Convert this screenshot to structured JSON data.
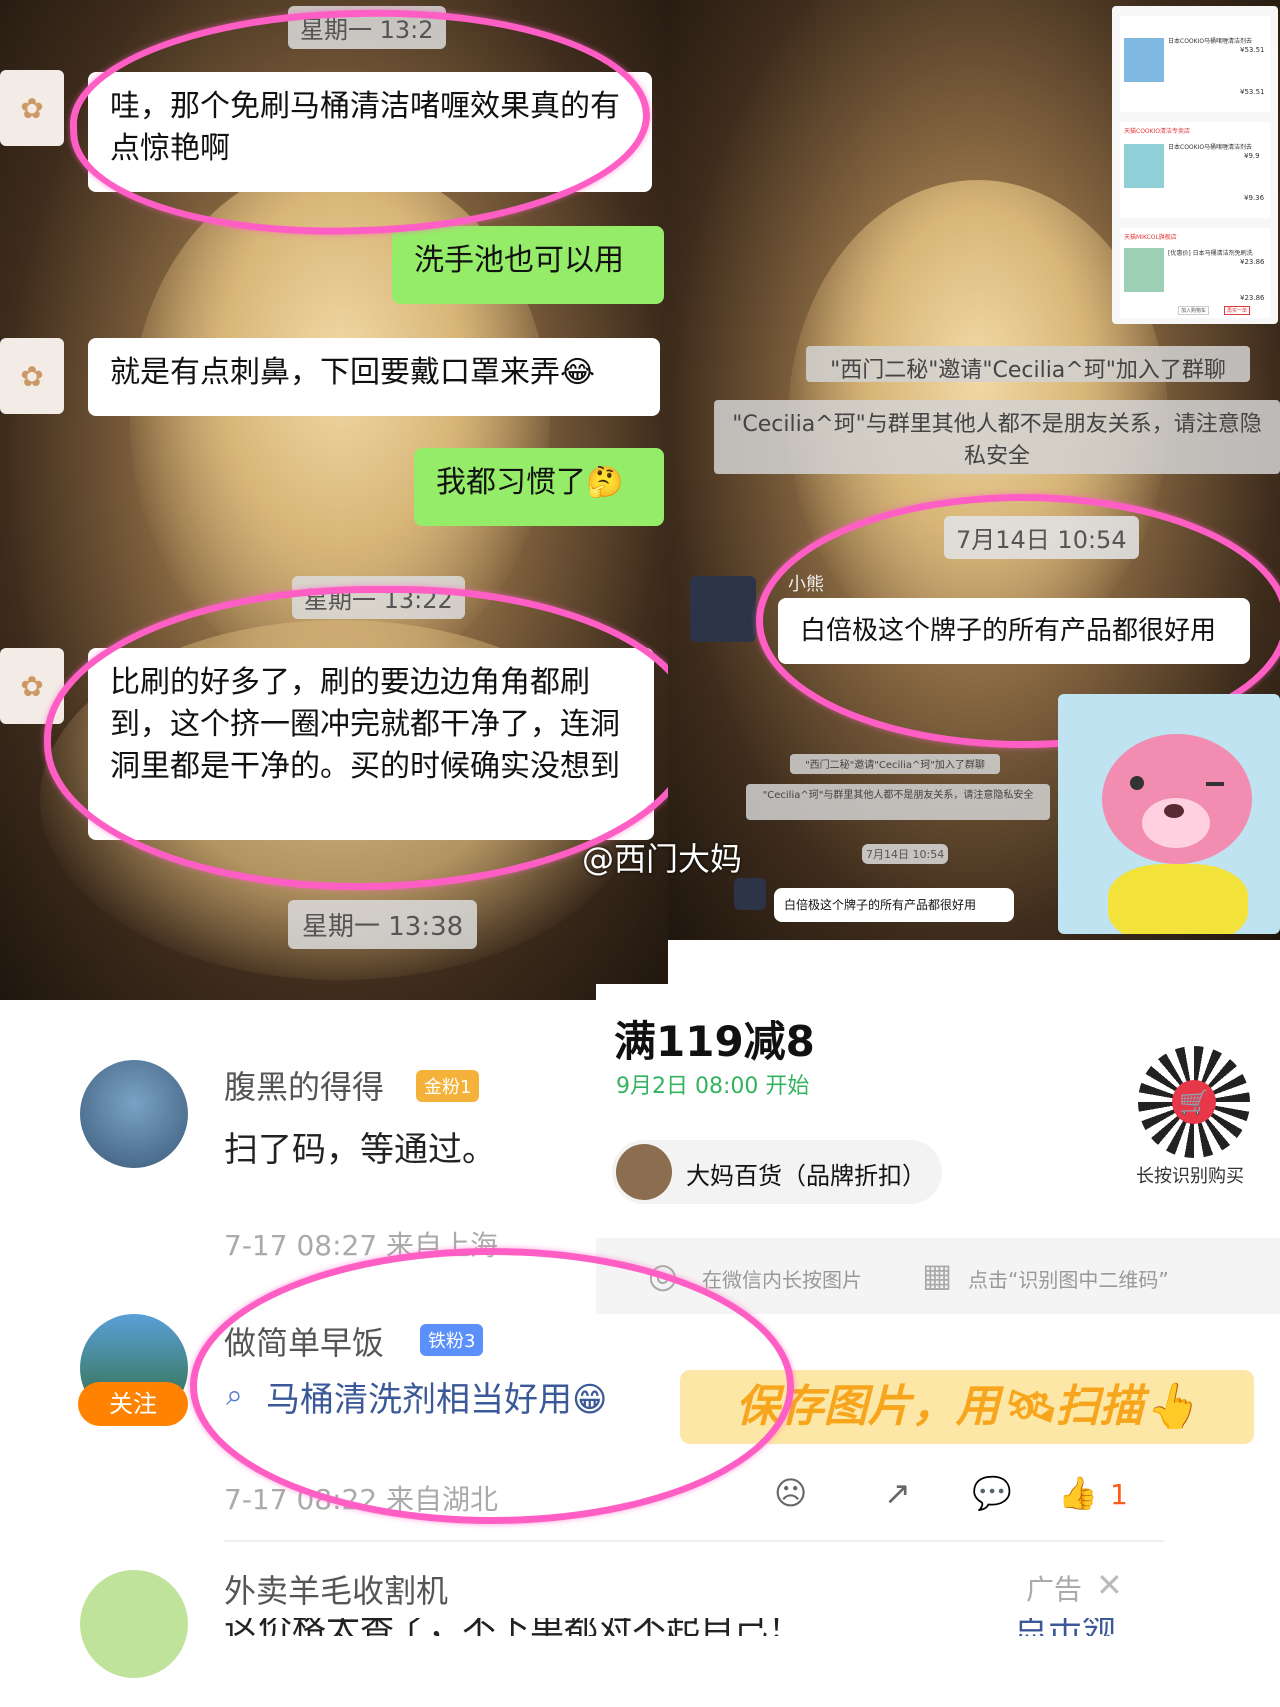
{
  "left_chat": {
    "time_top": "星期一 13:2",
    "msg1": "哇，那个免刷马桶清洁啫喱效果真的有点惊艳啊",
    "msg2_self": "洗手池也可以用",
    "msg3": "就是有点刺鼻，下回要戴口罩来弄😂",
    "msg4_self": "我都习惯了🤔",
    "time_mid": "星期一 13:22",
    "msg5": "比刷的好多了，刷的要边边角角都刷到，这个挤一圈冲完就都干净了，连洞洞里都是干净的。买的时候确实没想到",
    "time_bottom": "星期一 13:38"
  },
  "right_chat": {
    "sys1": "\"西门二秘\"邀请\"Cecilia^珂\"加入了群聊",
    "sys2": "\"Cecilia^珂\"与群里其他人都不是朋友关系，请注意隐私安全",
    "time": "7月14日 10:54",
    "sender": "小熊",
    "msg": "白倍极这个牌子的所有产品都很好用",
    "mini_sys1": "\"西门二秘\"邀请\"Cecilia^珂\"加入了群聊",
    "mini_sys2": "\"Cecilia^珂\"与群里其他人都不是朋友关系，请注意隐私安全",
    "mini_time": "7月14日 10:54",
    "mini_msg": "白倍极这个牌子的所有产品都很好用"
  },
  "shop_list": {
    "items": [
      {
        "shop": "",
        "title": "日本COOKIO马桶啫喱清洁剂去",
        "price": "¥53.51",
        "paid": "¥53.51"
      },
      {
        "shop": "天猫COOKIO清洁专卖店",
        "title": "日本COOKIO马桶啫喱清洁剂去",
        "price": "¥9.9",
        "paid": "¥9.36"
      },
      {
        "shop": "天猫MIKCOL旗舰店",
        "title": "[优惠价] 日本马桶清洁剂免刷洗",
        "price": "¥23.86",
        "paid": "¥23.86"
      }
    ],
    "buttons": [
      "加入购物车",
      "再买一单"
    ]
  },
  "watermark": "@西门大妈",
  "promo": {
    "headline": "满119减8",
    "start": "9月2日 08:00 开始",
    "shop": "大妈百货（品牌折扣）",
    "qr_caption": "长按识别购买",
    "hint1": "在微信内长按图片",
    "hint2": "点击“识别图中二维码”",
    "save_banner": "保存图片，用🛰扫描👆"
  },
  "comments": [
    {
      "name": "腹黑的得得",
      "badge": "金粉1",
      "text": "扫了码，等通过。",
      "meta": "7-17 08:27  来自上海"
    },
    {
      "name": "做简单早饭",
      "badge": "铁粉3",
      "text": "马桶清洗剂相当好用😁",
      "meta": "7-17 08:22  来自湖北",
      "follow": "关注",
      "likes": "1"
    },
    {
      "name": "外卖羊毛收割机",
      "text": "这价格太香了，不下单都对不起自己！",
      "ad": "广告",
      "cta": "点击领"
    }
  ],
  "colors": {
    "highlight_pink": "#ff5fc4",
    "wechat_green": "#95ec69",
    "promo_green": "#34b35f",
    "gold_badge": "#f5b23a",
    "iron_badge": "#5b8ff9",
    "save_orange": "#f7a51c"
  }
}
